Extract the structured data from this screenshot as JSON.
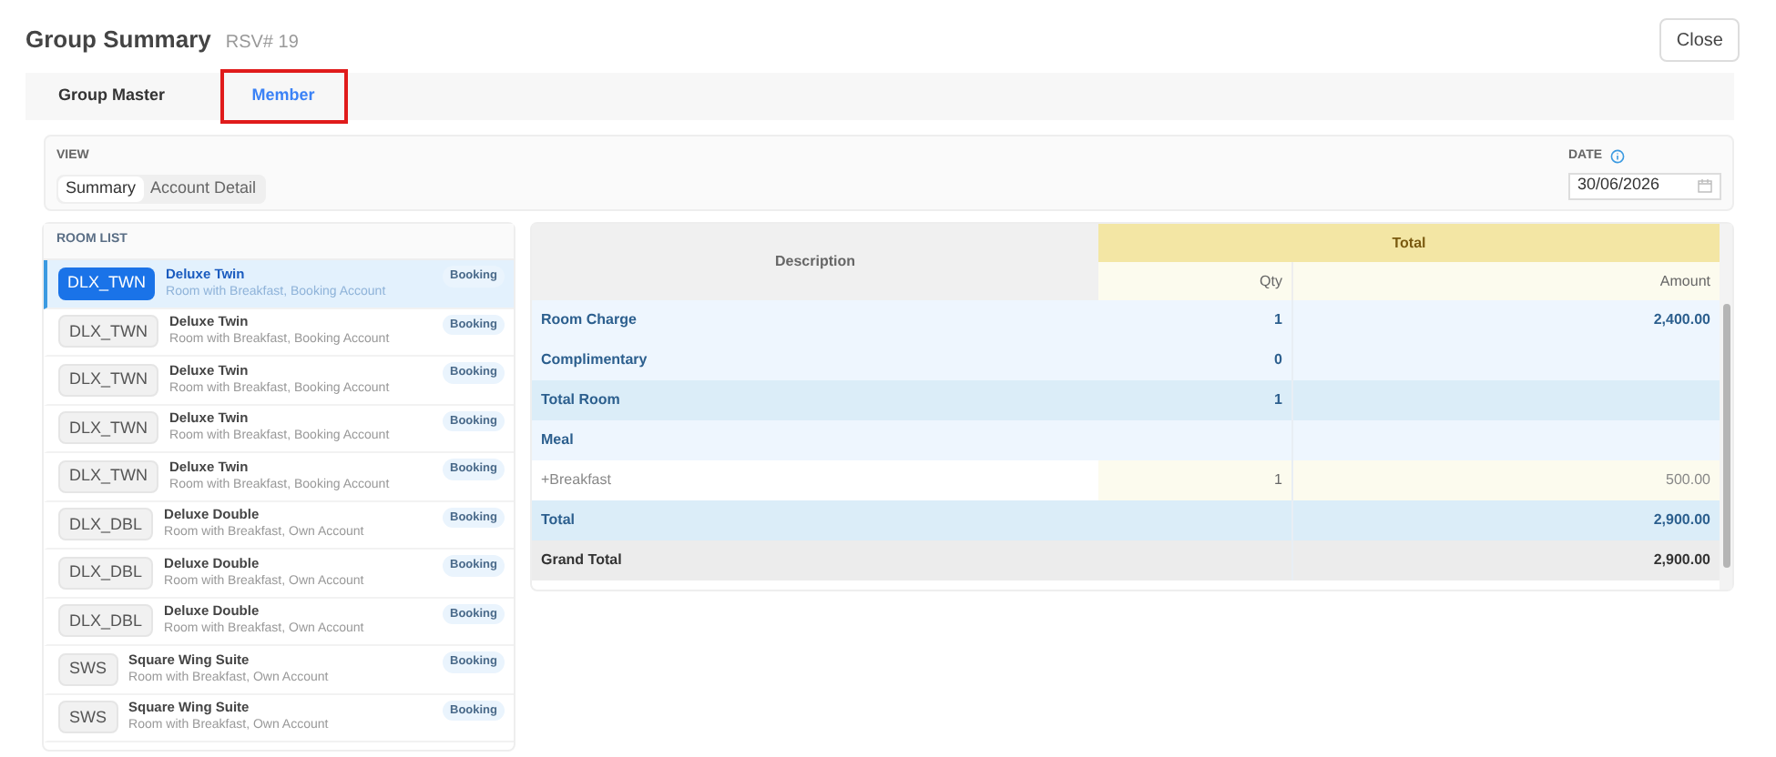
{
  "title": "Group Summary",
  "reservation": "RSV# 19",
  "close_button": "Close",
  "tabs": [
    {
      "label": "Group Master",
      "selected": false
    },
    {
      "label": "Member",
      "selected": true
    }
  ],
  "view": {
    "label": "VIEW",
    "options": [
      {
        "label": "Summary",
        "selected": true
      },
      {
        "label": "Account Detail",
        "selected": false
      }
    ]
  },
  "date": {
    "label": "DATE",
    "value": "30/06/2026"
  },
  "room_list": {
    "title": "ROOM LIST",
    "rooms": [
      {
        "code": "DLX_TWN",
        "name": "Deluxe Twin",
        "detail": "Room with Breakfast, Booking Account",
        "badge": "Booking",
        "selected": true
      },
      {
        "code": "DLX_TWN",
        "name": "Deluxe Twin",
        "detail": "Room with Breakfast, Booking Account",
        "badge": "Booking",
        "selected": false
      },
      {
        "code": "DLX_TWN",
        "name": "Deluxe Twin",
        "detail": "Room with Breakfast, Booking Account",
        "badge": "Booking",
        "selected": false
      },
      {
        "code": "DLX_TWN",
        "name": "Deluxe Twin",
        "detail": "Room with Breakfast, Booking Account",
        "badge": "Booking",
        "selected": false
      },
      {
        "code": "DLX_TWN",
        "name": "Deluxe Twin",
        "detail": "Room with Breakfast, Booking Account",
        "badge": "Booking",
        "selected": false
      },
      {
        "code": "DLX_DBL",
        "name": "Deluxe Double",
        "detail": "Room with Breakfast, Own Account",
        "badge": "Booking",
        "selected": false
      },
      {
        "code": "DLX_DBL",
        "name": "Deluxe Double",
        "detail": "Room with Breakfast, Own Account",
        "badge": "Booking",
        "selected": false
      },
      {
        "code": "DLX_DBL",
        "name": "Deluxe Double",
        "detail": "Room with Breakfast, Own Account",
        "badge": "Booking",
        "selected": false
      },
      {
        "code": "SWS",
        "name": "Square Wing Suite",
        "detail": "Room with Breakfast, Own Account",
        "badge": "Booking",
        "selected": false
      },
      {
        "code": "SWS",
        "name": "Square Wing Suite",
        "detail": "Room with Breakfast, Own Account",
        "badge": "Booking",
        "selected": false
      }
    ]
  },
  "table": {
    "columns": {
      "description": "Description",
      "group": "Total",
      "qty": "Qty",
      "amount": "Amount"
    },
    "rows": [
      {
        "kind": "line",
        "description": "Room Charge",
        "qty": "1",
        "amount": "2,400.00"
      },
      {
        "kind": "line",
        "description": "Complimentary",
        "qty": "0"
      },
      {
        "kind": "subtotal",
        "description": "Total Room",
        "qty": "1"
      },
      {
        "kind": "line",
        "description": "Meal"
      },
      {
        "kind": "item",
        "description": "+Breakfast",
        "qty": "1",
        "amount": "500.00"
      },
      {
        "kind": "subtotal",
        "description": "Total",
        "amount": "2,900.00"
      },
      {
        "kind": "grand",
        "description": "Grand Total",
        "amount": "2,900.00"
      }
    ]
  }
}
